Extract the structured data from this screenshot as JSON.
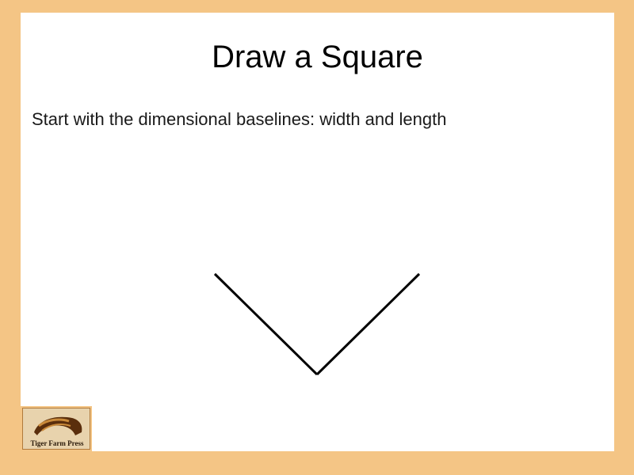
{
  "slide": {
    "title": "Draw a Square",
    "body": "Start with the dimensional baselines: width and length"
  },
  "logo": {
    "text": "Tiger Farm Press",
    "icon": "tiger-farm-press-logo-icon"
  },
  "colors": {
    "border": "#f4c585",
    "slide_background": "#ffffff",
    "line": "#000000"
  }
}
